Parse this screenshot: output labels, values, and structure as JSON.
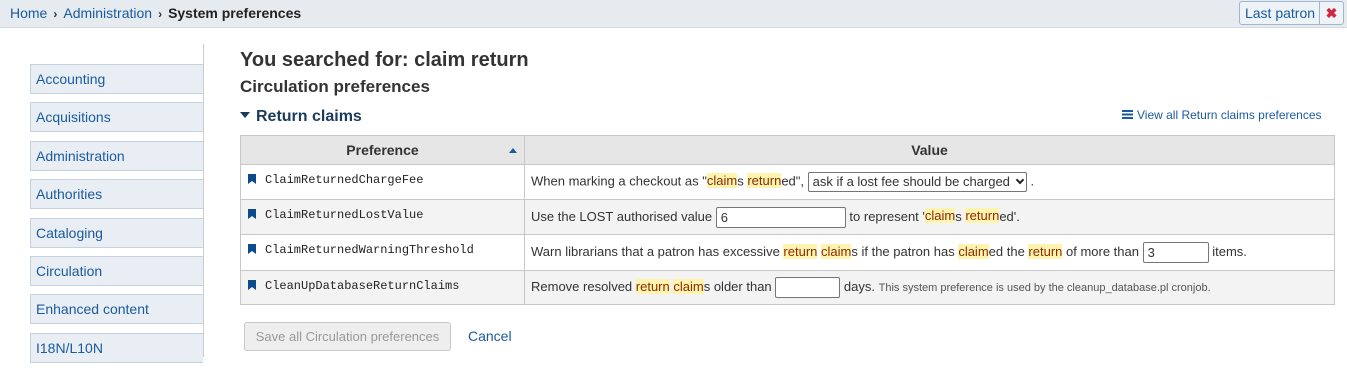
{
  "breadcrumb": {
    "home": "Home",
    "admin": "Administration",
    "current": "System preferences",
    "sep": "›"
  },
  "last_patron": {
    "label": "Last patron",
    "close": "✖"
  },
  "sidebar": {
    "items": [
      "Accounting",
      "Acquisitions",
      "Administration",
      "Authorities",
      "Cataloging",
      "Circulation",
      "Enhanced content",
      "I18N/L10N"
    ]
  },
  "search_heading": "You searched for: claim return",
  "section_heading": "Circulation preferences",
  "group_heading": "Return claims",
  "view_all_link": "View all Return claims preferences",
  "table": {
    "headers": {
      "preference": "Preference",
      "value": "Value"
    },
    "rows": [
      {
        "name": "ClaimReturnedChargeFee",
        "t1": "When marking a checkout as \"",
        "h1": "claim",
        "t2": "s ",
        "h2": "return",
        "t3": "ed\",",
        "select_value": "ask if a lost fee should be charged",
        "t4": "."
      },
      {
        "name": "ClaimReturnedLostValue",
        "t1": "Use the LOST authorised value",
        "input_value": "6",
        "t2": "to represent '",
        "h1": "claim",
        "t3": "s ",
        "h2": "return",
        "t4": "ed'."
      },
      {
        "name": "ClaimReturnedWarningThreshold",
        "t1": "Warn librarians that a patron has excessive ",
        "h1": "return",
        "t2": " ",
        "h2": "claim",
        "t3": "s if the patron has ",
        "h3": "claim",
        "t4": "ed the ",
        "h4": "return",
        "t5": " of more than",
        "input_value": "3",
        "t6": "items."
      },
      {
        "name": "CleanUpDatabaseReturnClaims",
        "t1": "Remove resolved ",
        "h1": "return",
        "t2": " ",
        "h2": "claim",
        "t3": "s older than",
        "input_value": "",
        "t4": "days.",
        "note": "This system preference is used by the cleanup_database.pl cronjob."
      }
    ]
  },
  "save_button": "Save all Circulation preferences",
  "cancel_link": "Cancel",
  "colors": {
    "link": "#1a5a9e",
    "highlight": "#fff3b0",
    "heading": "#1b3a5c"
  }
}
